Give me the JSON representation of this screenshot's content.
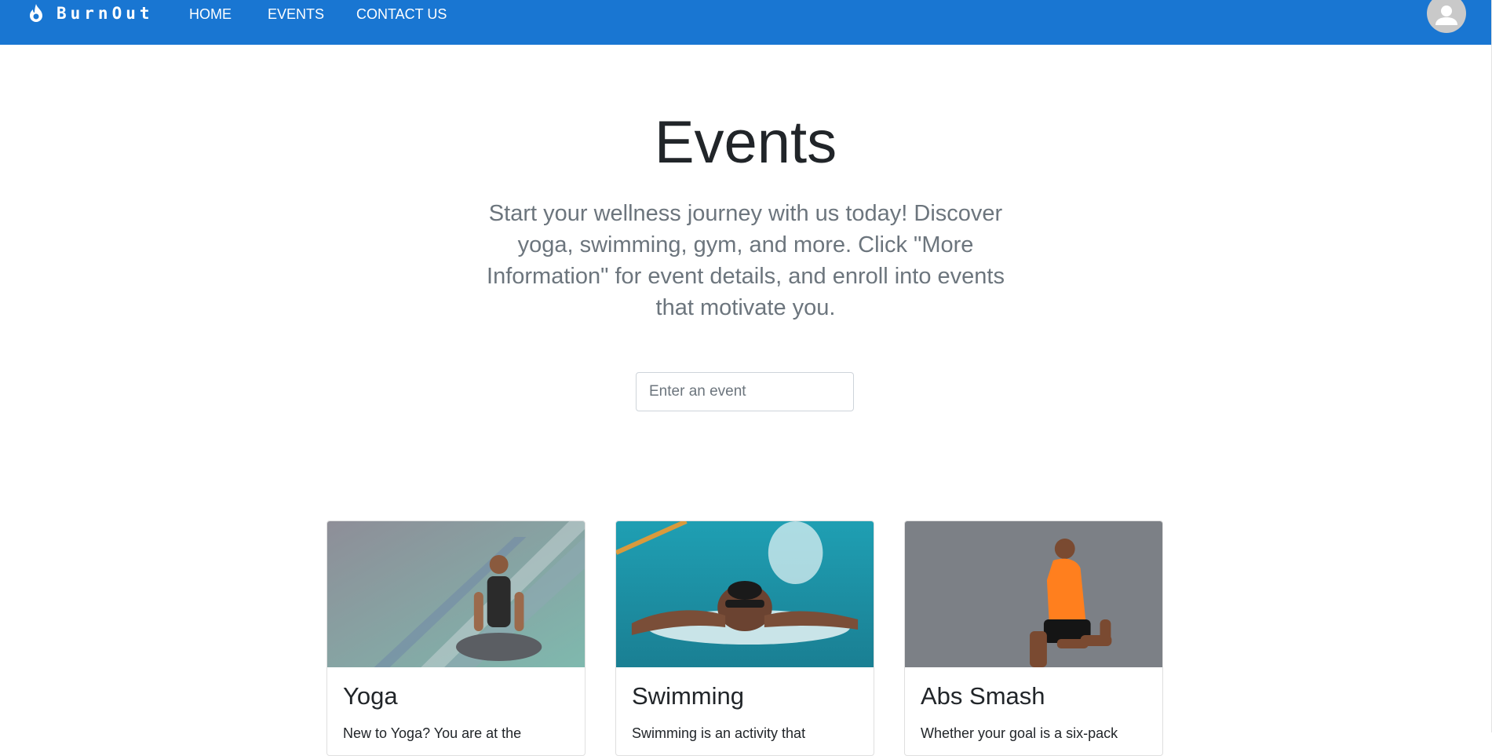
{
  "brand": {
    "name": "BurnOut",
    "icon": "flame-icon"
  },
  "nav": {
    "items": [
      {
        "label": "HOME"
      },
      {
        "label": "EVENTS"
      },
      {
        "label": "CONTACT US"
      }
    ]
  },
  "user": {
    "icon": "user-avatar-icon"
  },
  "header": {
    "title": "Events",
    "lead": "Start your wellness journey with us today! Discover yoga, swimming, gym, and more. Click \"More Information\" for event details, and enroll into events that motivate you."
  },
  "search": {
    "placeholder": "Enter an event",
    "value": ""
  },
  "events": [
    {
      "title": "Yoga",
      "description": "New to Yoga? You are at the",
      "image": "yoga-photo"
    },
    {
      "title": "Swimming",
      "description": "Swimming is an activity that",
      "image": "swimming-photo"
    },
    {
      "title": "Abs Smash",
      "description": "Whether your goal is a six-pack",
      "image": "abs-smash-photo"
    }
  ],
  "colors": {
    "navbar": "#1976d2",
    "lead_text": "#6c757d",
    "border": "#ced4da"
  }
}
